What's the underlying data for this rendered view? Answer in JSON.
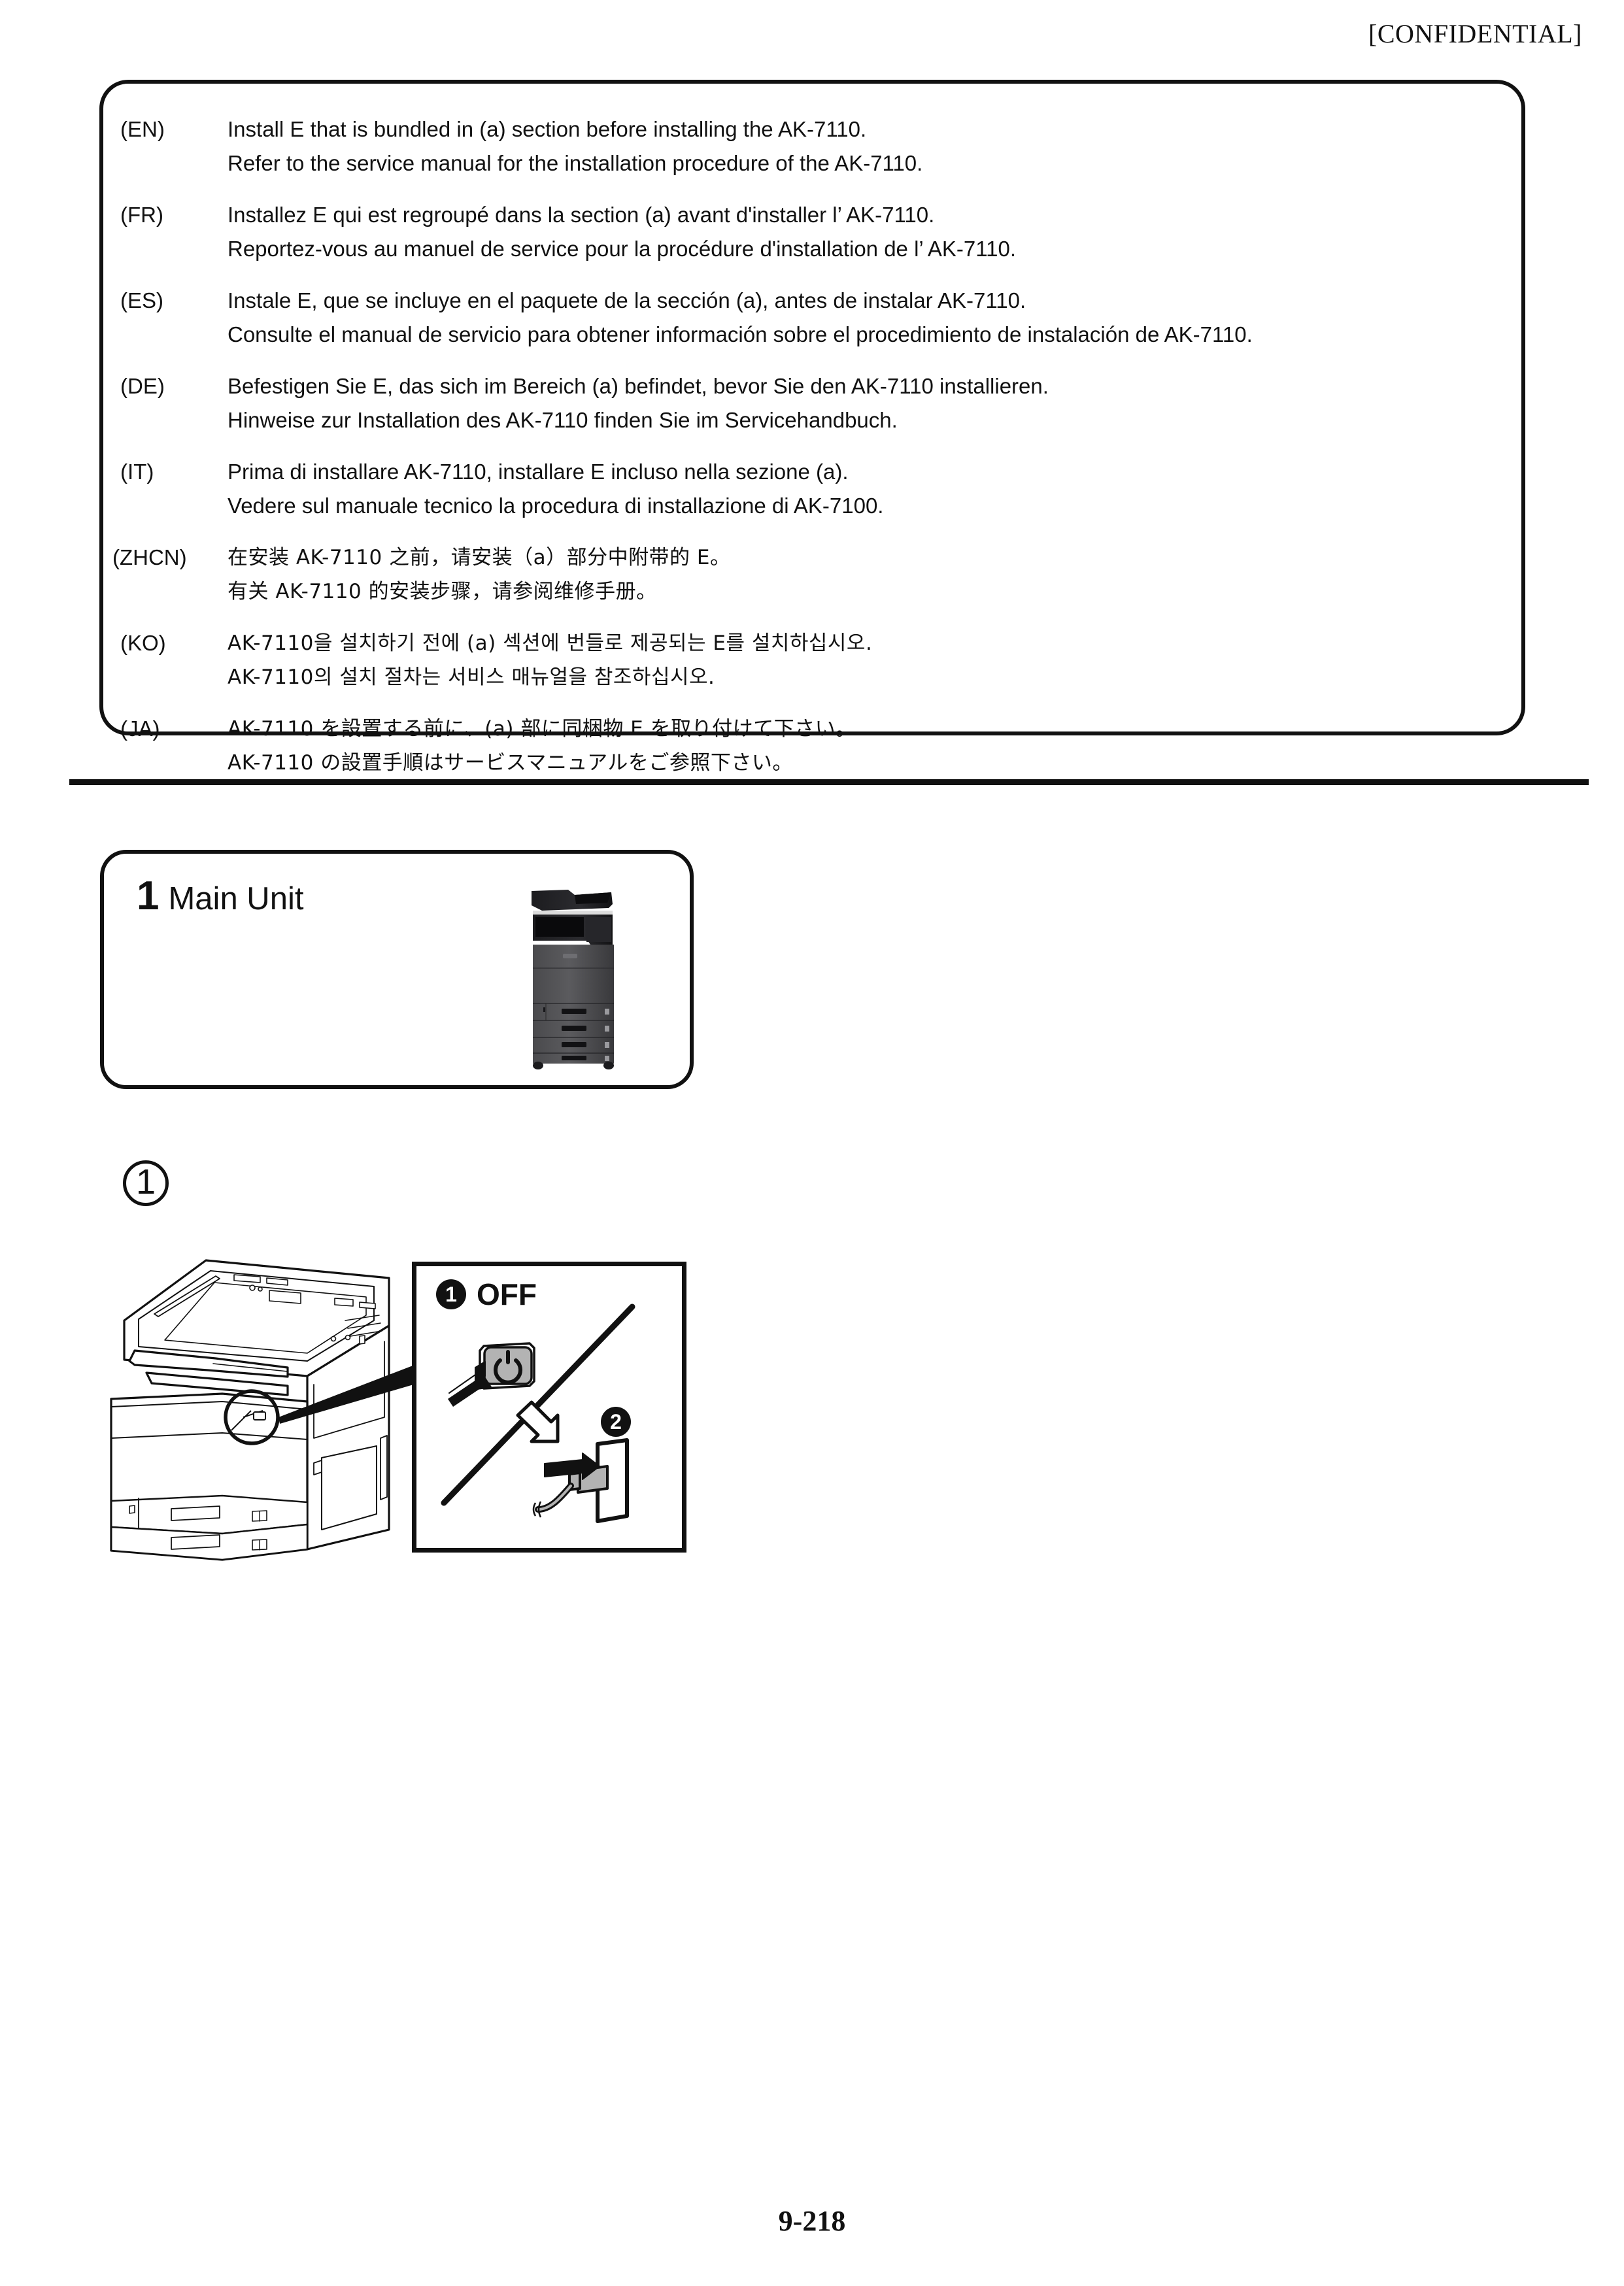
{
  "header": {
    "classification": "[CONFIDENTIAL]"
  },
  "note_box": {
    "rows": [
      {
        "lang": "(EN)",
        "lines": [
          "Install E that is bundled in (a) section before installing the AK-7110.",
          "Refer to the service manual for the installation procedure of the AK-7110."
        ]
      },
      {
        "lang": "(FR)",
        "lines": [
          "Installez E qui est regroupé dans la section (a) avant d'installer l’ AK-7110.",
          "Reportez-vous au manuel de service pour la procédure d'installation de l’ AK-7110."
        ]
      },
      {
        "lang": "(ES)",
        "lines": [
          "Instale E, que se incluye en el paquete de la sección (a), antes de instalar AK-7110.",
          "Consulte el manual de servicio para obtener información sobre el procedimiento de instalación de AK-7110."
        ]
      },
      {
        "lang": "(DE)",
        "lines": [
          "Befestigen Sie E, das sich im Bereich (a) befindet, bevor Sie den AK-7110 installieren.",
          "Hinweise zur Installation des AK-7110 finden Sie im Servicehandbuch."
        ]
      },
      {
        "lang": "(IT)",
        "lines": [
          "Prima di installare AK-7110, installare E incluso nella sezione (a).",
          "Vedere sul manuale tecnico la procedura di installazione di AK-7100."
        ]
      },
      {
        "lang": "(ZHCN)",
        "lines": [
          "在安装 AK-7110 之前，请安装（a）部分中附带的 E。",
          "有关 AK-7110 的安装步骤，请参阅维修手册。"
        ]
      },
      {
        "lang": "(KO)",
        "lines": [
          "AK-7110을 설치하기 전에 (a) 섹션에 번들로 제공되는 E를 설치하십시오.",
          "AK-7110의 설치 절차는 서비스 매뉴얼을 참조하십시오."
        ]
      },
      {
        "lang": "(JA)",
        "lines": [
          "AK-7110 を設置する前に、(a) 部に同梱物 E を取り付けて下さい。",
          "AK-7110 の設置手順はサービスマニュアルをご参照下さい。"
        ]
      }
    ]
  },
  "parts_box": {
    "quantity": "1",
    "label": "Main Unit",
    "photo_icon": "multifunction-printer-photo"
  },
  "procedure": {
    "step_number": "1",
    "machine_icon": "multifunction-printer-line-art",
    "callout_panel": {
      "badge_one": "1",
      "badge_two": "2",
      "action_label": "OFF",
      "power_button_icon": "power-symbol",
      "plug_icon": "power-plug-outlet"
    }
  },
  "footer": {
    "page_number": "9-218"
  },
  "colors": {
    "ink": "#111111",
    "paper": "#ffffff",
    "button_face": "#b3b3b3"
  }
}
